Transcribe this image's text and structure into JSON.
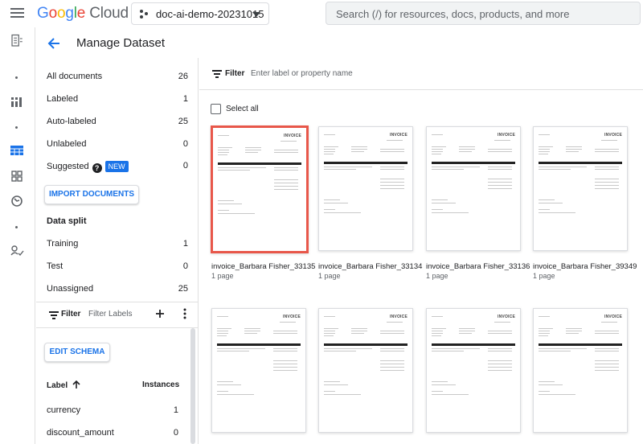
{
  "topbar": {
    "logo_letters": [
      "G",
      "o",
      "o",
      "g",
      "l",
      "e"
    ],
    "logo_suffix": "Cloud",
    "project_name": "doc-ai-demo-20231015",
    "search_placeholder": "Search (/) for resources, docs, products, and more"
  },
  "header": {
    "title": "Manage Dataset"
  },
  "stats": [
    {
      "label": "All documents",
      "count": "26"
    },
    {
      "label": "Labeled",
      "count": "1"
    },
    {
      "label": "Auto-labeled",
      "count": "25"
    },
    {
      "label": "Unlabeled",
      "count": "0"
    },
    {
      "label": "Suggested",
      "count": "0",
      "badge": "NEW"
    }
  ],
  "import_button": "IMPORT DOCUMENTS",
  "data_split": {
    "title": "Data split",
    "items": [
      {
        "label": "Training",
        "count": "1"
      },
      {
        "label": "Test",
        "count": "0"
      },
      {
        "label": "Unassigned",
        "count": "25"
      }
    ]
  },
  "label_filter": {
    "label": "Filter",
    "placeholder": "Filter Labels"
  },
  "edit_schema_button": "EDIT SCHEMA",
  "labels_table": {
    "col_label": "Label",
    "col_instances": "Instances",
    "rows": [
      {
        "label": "currency",
        "instances": "1"
      },
      {
        "label": "discount_amount",
        "instances": "0"
      }
    ]
  },
  "main_filter": {
    "label": "Filter",
    "placeholder": "Enter label or property name"
  },
  "select_all": "Select all",
  "documents": [
    {
      "name": "invoice_Barbara Fisher_33135",
      "pages": "1 page",
      "selected": true
    },
    {
      "name": "invoice_Barbara Fisher_33134",
      "pages": "1 page",
      "selected": false
    },
    {
      "name": "invoice_Barbara Fisher_33136",
      "pages": "1 page",
      "selected": false
    },
    {
      "name": "invoice_Barbara Fisher_39349",
      "pages": "1 page",
      "selected": false
    },
    {
      "name": "",
      "pages": "",
      "selected": false
    },
    {
      "name": "",
      "pages": "",
      "selected": false
    },
    {
      "name": "",
      "pages": "",
      "selected": false
    },
    {
      "name": "",
      "pages": "",
      "selected": false
    }
  ],
  "thumbnail_heading": "INVOICE",
  "colors": {
    "accent": "#1a73e8",
    "selected_border": "#e8574a",
    "rail_selected": "#1a73e8"
  }
}
